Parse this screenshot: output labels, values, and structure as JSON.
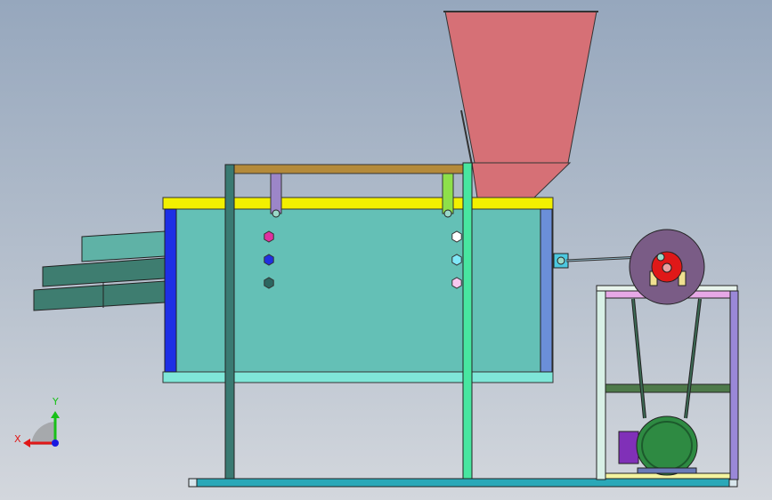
{
  "triad": {
    "x_label": "X",
    "y_label": "Y"
  },
  "colors": {
    "hopper": "#d67076",
    "drum_body": "#64c0b6",
    "top_rail": "#f2f000",
    "bottom_rail": "#7fe6d8",
    "left_cap": "#1d2fe6",
    "right_cap": "#6b8fd8",
    "frame_post_left": "#3a7a72",
    "frame_post_right": "#48e6a0",
    "top_beam": "#b48a3a",
    "base_rail": "#2aa8b8",
    "hanger_left": "#9c86c8",
    "hanger_right": "#8ee04a",
    "chute_light": "#5fb2a6",
    "chute_dark": "#3e7d70",
    "pulley": "#7a5c86",
    "crank": "#e01818",
    "motor": "#2e8a42",
    "motor_cap": "#8030b8",
    "stand_frame": "#d8f0e6",
    "stand_top": "#e6a8e6",
    "stand_shelf": "#4e7a4a",
    "stand_side": "#9a88d8",
    "belt": "#3c6a54",
    "axis_x": "#e01818",
    "axis_y": "#18c018",
    "axis_z": "#1818e0"
  },
  "bolts_left": [
    "#e030a0",
    "#2030e0",
    "#2c6660"
  ],
  "bolts_right": [
    "#ffffff",
    "#80e8f8",
    "#f8c8f0"
  ]
}
